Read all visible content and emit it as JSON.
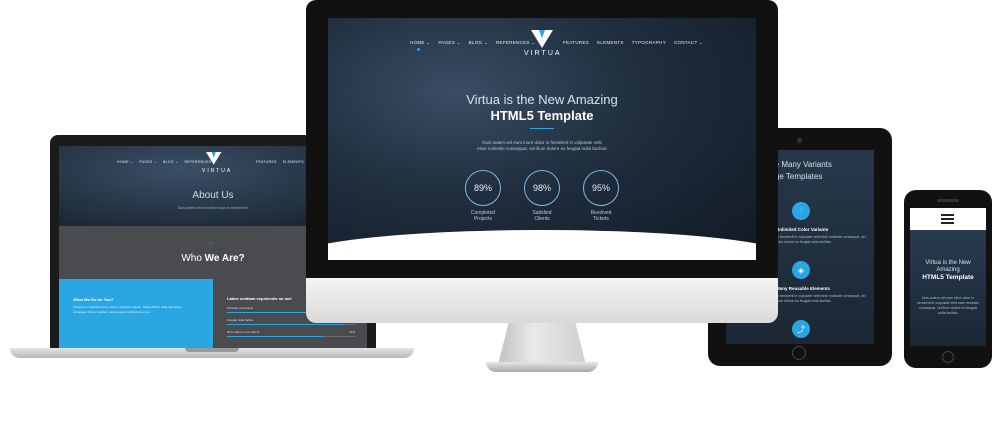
{
  "monitor": {
    "logo_text": "VIRTUA",
    "nav": [
      "HOME ⌄",
      "PAGES ⌄",
      "BLOG ⌄",
      "REFERENCES ⌄",
      "FEATURES",
      "ELEMENTS",
      "TYPOGRAPHY",
      "CONTACT ⌄"
    ],
    "hero_line1": "Virtua is the New Amazing",
    "hero_line2": "HTML5 Template",
    "hero_text_1": "Duis autem vel eum iriure dolor in hendrerit in vulputate velit",
    "hero_text_2": "esse molestie consequat, vel illum dolore eu feugiat nulla facilisis",
    "stats": [
      {
        "value": "89%",
        "label_1": "Completed",
        "label_2": "Projects"
      },
      {
        "value": "98%",
        "label_1": "Satisfied",
        "label_2": "Clients"
      },
      {
        "value": "95%",
        "label_1": "Resolved",
        "label_2": "Tickets"
      }
    ]
  },
  "laptop": {
    "logo_text": "VIRTUA",
    "nav": [
      "HOME ⌄",
      "PAGES ⌄",
      "BLOG ⌄",
      "REFERENCES ⌄",
      "FEATURES",
      "ELEMENTS",
      "TYPOGRAPHY",
      "CONTACT ⌄"
    ],
    "page_title": "About Us",
    "page_sub": "Duis autem vel eum iriure dolor in hendrerit in",
    "who_light": "Who",
    "who_bold": "We Are?",
    "card_title": "What We Do for You?",
    "card_text": "Vivamus in vulputate risus, quis ex interdum sapien. Nulla efficitur nulla nec luctus consequat. Donec pretium, augue eget tincidunt ipsum ac...",
    "skills_title": "Latine omittam expetendis no mei",
    "skills": [
      {
        "label": "Molestie consequat",
        "value": ""
      },
      {
        "label": "Feugiat nulla facilisi",
        "value": ""
      },
      {
        "label": "Illum dolore eu hendrerit",
        "value": "75%"
      }
    ]
  },
  "tablet": {
    "heading_1": "the Many Variants",
    "heading_2": "page Templates",
    "features": [
      {
        "icon": "sliders-icon",
        "glyph": "⫶",
        "title": "Unlimited Color Variants",
        "text": "in hendrerit in vulputate velit esse molestie consequat, vel illum dolore eu feugiat nulla facilisis"
      },
      {
        "icon": "cube-icon",
        "glyph": "◈",
        "title": "Many Reusable Elements",
        "text": "in hendrerit in vulputate velit esse molestie consequat, vel illum dolore eu feugiat nulla facilisis"
      },
      {
        "icon": "share-icon",
        "glyph": "⤴",
        "title": "",
        "text": ""
      }
    ]
  },
  "phone": {
    "menu_icon": "menu-icon",
    "hero_line1": "Virtua is the New",
    "hero_line2": "Amazing",
    "hero_line3": "HTML5 Template",
    "hero_text": "Duis autem vel eum iriure dolor in hendrerit in vulputate velit esse molestie consequat, vel illum dolore eu feugiat nulla facilisis"
  },
  "colors": {
    "accent": "#2aa6e3",
    "dark": "#1c2836"
  }
}
